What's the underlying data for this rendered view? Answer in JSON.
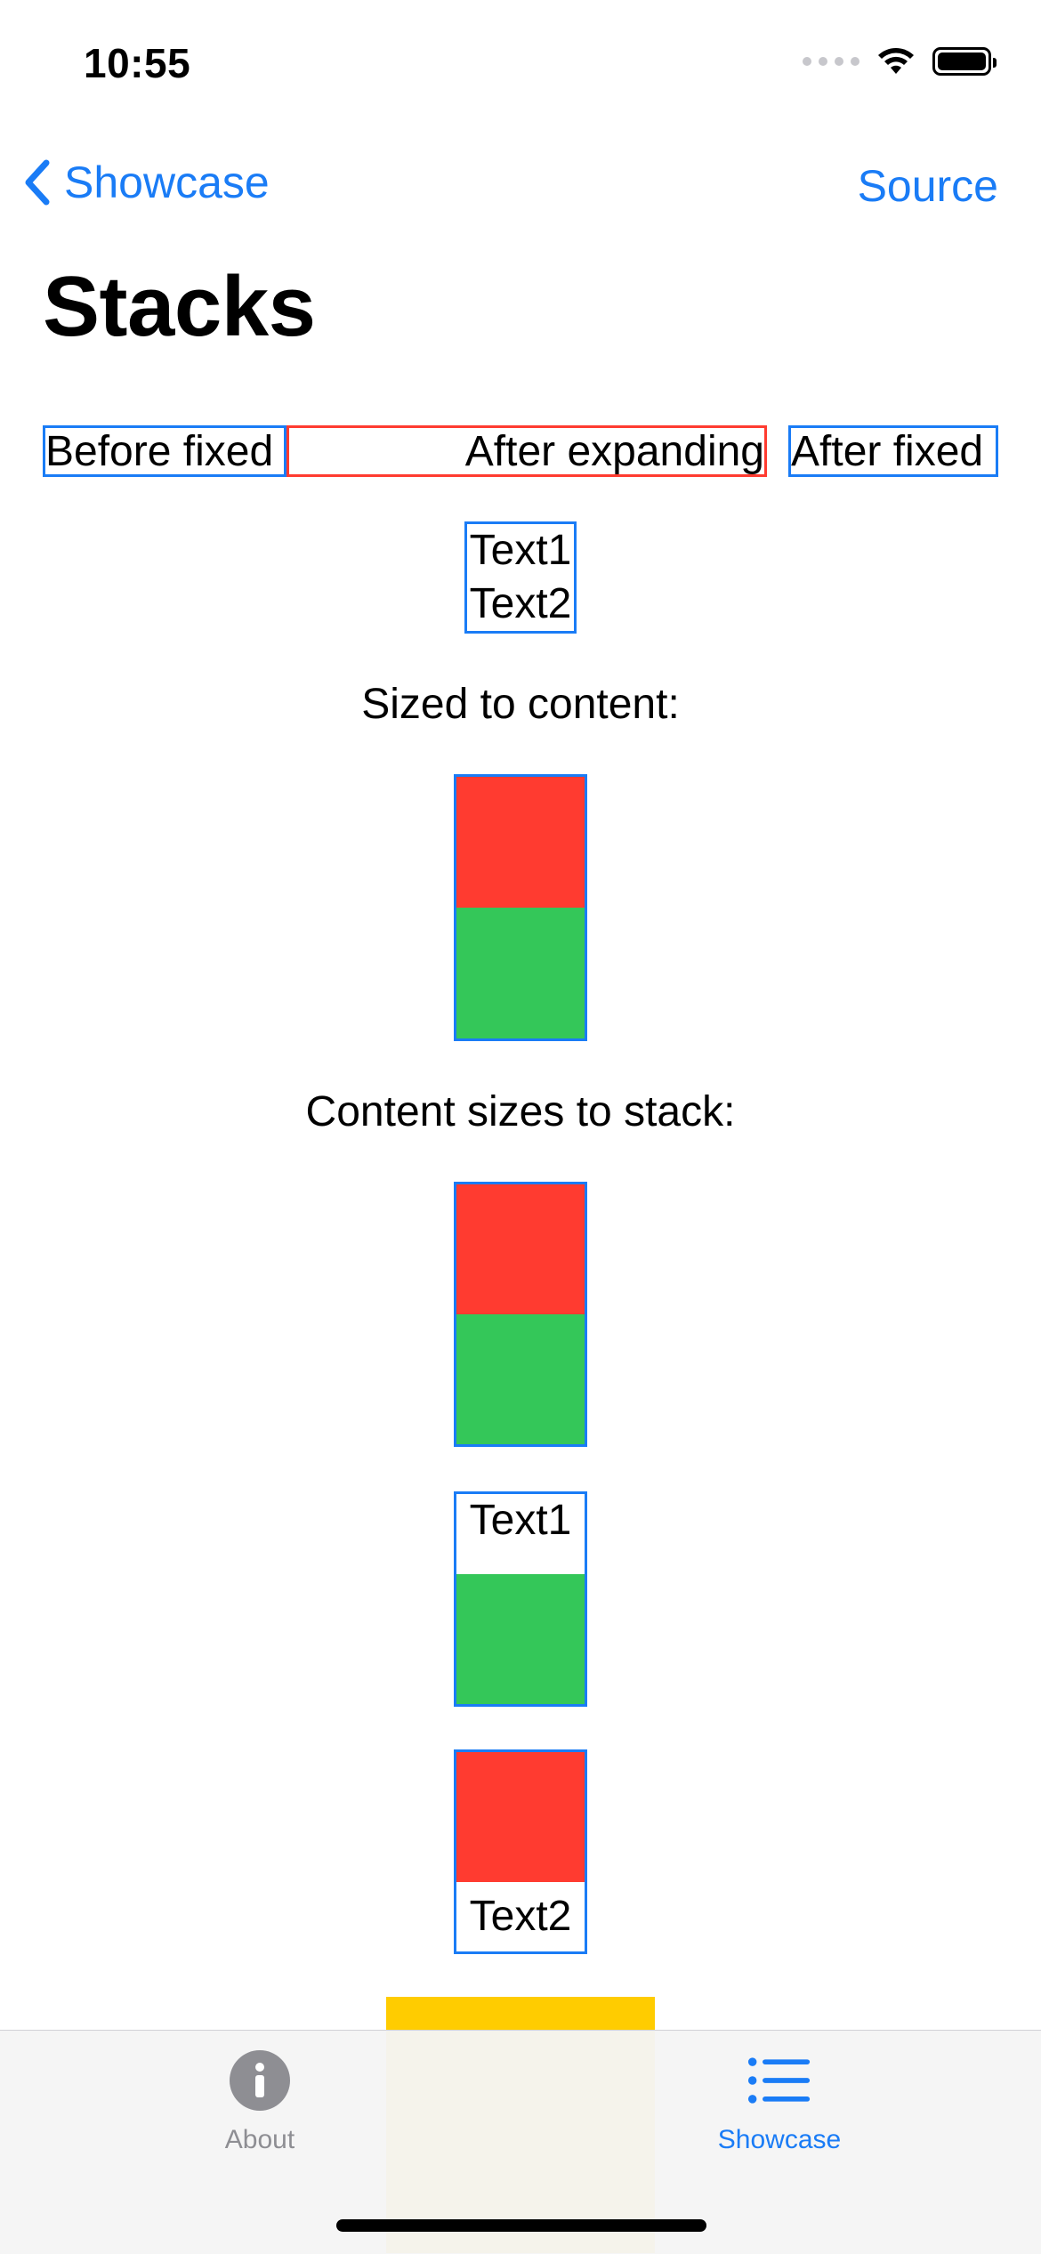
{
  "status_bar": {
    "time": "10:55"
  },
  "nav": {
    "back_label": "Showcase",
    "right_label": "Source"
  },
  "page": {
    "title": "Stacks"
  },
  "row": {
    "before_fixed": "Before fixed",
    "after_expanding": "After expanding",
    "after_fixed": "After fixed"
  },
  "vstack_texts": {
    "text1": "Text1",
    "text2": "Text2"
  },
  "labels": {
    "sized_to_content": "Sized to content:",
    "content_sizes_to_stack": "Content sizes to stack:"
  },
  "mixed_stack_a": {
    "text": "Text1"
  },
  "mixed_stack_b": {
    "text": "Text2"
  },
  "colors": {
    "accent": "#1a7cf6",
    "red": "#ff3b30",
    "green": "#34c759",
    "yellow": "#ffcc00"
  },
  "tabbar": {
    "tabs": [
      {
        "label": "About",
        "icon": "info-circle-icon",
        "selected": false
      },
      {
        "label": "Showcase",
        "icon": "list-icon",
        "selected": true
      }
    ]
  }
}
